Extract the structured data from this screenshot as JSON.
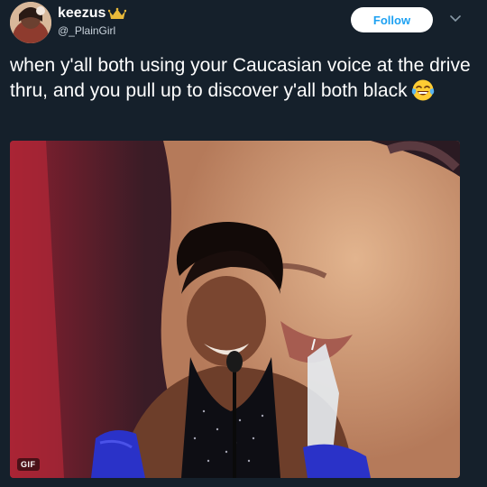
{
  "author": {
    "display_name": "keezus",
    "handle": "@_PlainGirl",
    "badge_icon": "crown-icon"
  },
  "actions": {
    "follow_label": "Follow",
    "menu_icon": "chevron-down-icon"
  },
  "tweet": {
    "text": "when y'all both using your Caucasian voice at the drive thru, and you pull up to discover y'all both black",
    "emoji": "face-with-tears-of-joy-icon"
  },
  "media": {
    "type_badge": "GIF"
  },
  "colors": {
    "background": "#15202b",
    "accent": "#1da1f2",
    "crown": "#e8b93a"
  }
}
